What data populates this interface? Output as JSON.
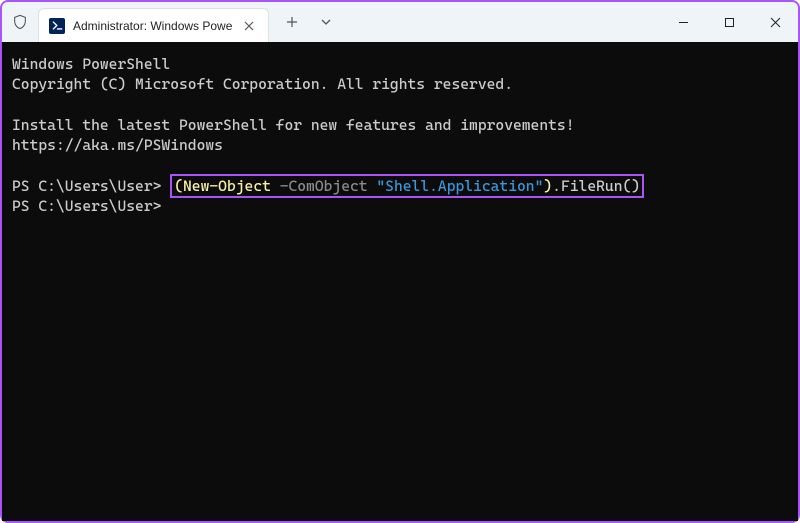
{
  "titlebar": {
    "tab_title": "Administrator: Windows Powe",
    "new_tab_label": "+",
    "dropdown_label": "⌄"
  },
  "terminal": {
    "line1": "Windows PowerShell",
    "line2": "Copyright (C) Microsoft Corporation. All rights reserved.",
    "line3": "Install the latest PowerShell for new features and improvements! https://aka.ms/PSWindows",
    "prompt1": "PS C:\\Users\\User> ",
    "prompt2": "PS C:\\Users\\User> ",
    "cmd": {
      "paren_open": "(",
      "cmdlet": "New-Object",
      "space1": " ",
      "param": "-ComObject",
      "space2": " ",
      "string": "\"Shell.Application\"",
      "paren_close": ")",
      "method": ".FileRun()"
    }
  }
}
